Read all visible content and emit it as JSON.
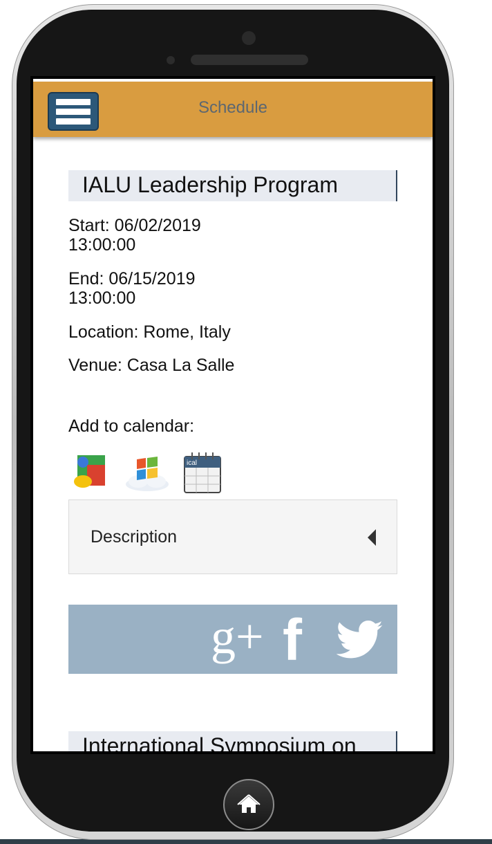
{
  "header": {
    "title": "Schedule"
  },
  "event": {
    "title": "IALU Leadership Program",
    "start_label": "Start: 06/02/2019",
    "start_time": "13:00:00",
    "end_label": "End: 06/15/2019",
    "end_time": "13:00:00",
    "location": "Location: Rome, Italy",
    "venue": "Venue: Casa La Salle",
    "add_to_calendar": "Add to calendar:",
    "calendar_icons": [
      "google-calendar-icon",
      "windows-live-calendar-icon",
      "ical-icon"
    ],
    "ical_label": "ical",
    "description_label": "Description"
  },
  "share": {
    "icons": [
      "google-plus-icon",
      "facebook-icon",
      "twitter-icon"
    ],
    "google_plus_text": "g+",
    "facebook_text": "f"
  },
  "next_event": {
    "title": "International Symposium on"
  },
  "colors": {
    "header_bg": "#d99c40",
    "menu_button_bg": "#2c5879",
    "share_bar_bg": "#9ab1c4",
    "title_box_bg": "#e8ebf1"
  }
}
